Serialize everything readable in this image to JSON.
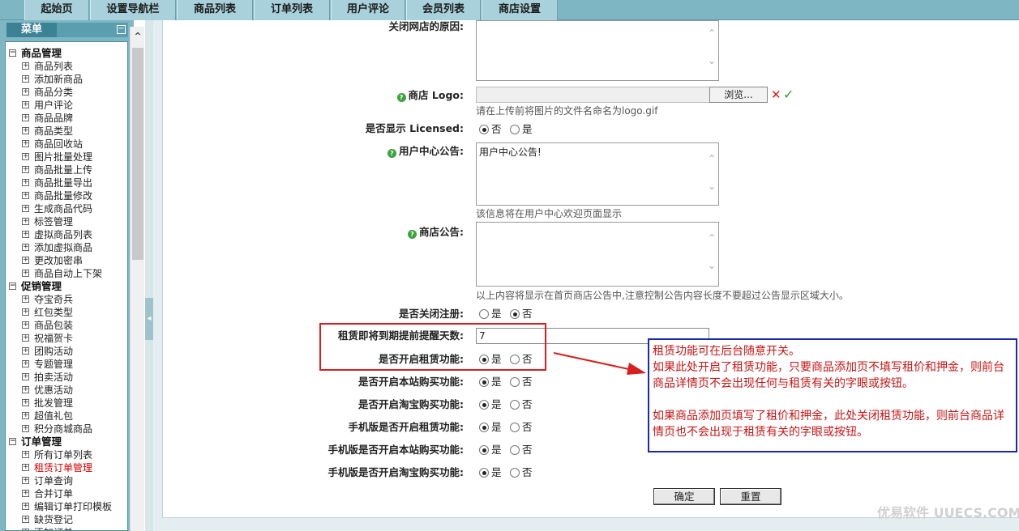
{
  "topnav": [
    "起始页",
    "设置导航栏",
    "商品列表",
    "订单列表",
    "用户评论",
    "会员列表",
    "商店设置"
  ],
  "menu": {
    "title": "菜单",
    "collapse": "−",
    "groups": [
      {
        "label": "商品管理",
        "items": [
          "商品列表",
          "添加新商品",
          "商品分类",
          "用户评论",
          "商品品牌",
          "商品类型",
          "商品回收站",
          "图片批量处理",
          "商品批量上传",
          "商品批量导出",
          "商品批量修改",
          "生成商品代码",
          "标签管理",
          "虚拟商品列表",
          "添加虚拟商品",
          "更改加密串",
          "商品自动上下架"
        ]
      },
      {
        "label": "促销管理",
        "items": [
          "夺宝奇兵",
          "红包类型",
          "商品包装",
          "祝福贺卡",
          "团购活动",
          "专题管理",
          "拍卖活动",
          "优惠活动",
          "批发管理",
          "超值礼包",
          "积分商城商品"
        ]
      },
      {
        "label": "订单管理",
        "items": [
          "所有订单列表",
          "租赁订单管理",
          "订单查询",
          "合并订单",
          "编辑订单打印模板",
          "缺货登记",
          "添加订单"
        ]
      }
    ],
    "active_item": "租赁订单管理"
  },
  "form": {
    "close_reason_label": "关闭网店的原因:",
    "close_reason_value": "",
    "logo_label": "商店  Logo:",
    "logo_browse": "浏览...",
    "logo_hint": "请在上传前将图片的文件名命名为logo.gif",
    "licensed_label": "是否显示  Licensed:",
    "licensed_opts": [
      "否",
      "是"
    ],
    "user_notice_label": "用户中心公告:",
    "user_notice_value": "用户中心公告!",
    "user_notice_hint": "该信息将在用户中心欢迎页面显示",
    "shop_notice_label": "商店公告:",
    "shop_notice_value": "",
    "shop_notice_hint": "以上内容将显示在首页商店公告中,注意控制公告内容长度不要超过公告显示区域大小。",
    "close_register_label": "是否关闭注册:",
    "close_register_opts": [
      "是",
      "否"
    ],
    "rent_days_label": "租赁即将到期提前提醒天数:",
    "rent_days_value": "7",
    "rent_enable_label": "是否开启租赁功能:",
    "site_buy_label": "是否开启本站购买功能:",
    "taobao_buy_label": "是否开启淘宝购买功能:",
    "mobile_rent_label": "手机版是否开启租赁功能:",
    "mobile_site_buy_label": "手机版是否开启本站购买功能:",
    "mobile_taobao_buy_label": "手机版是否开启淘宝购买功能:",
    "yes_no": [
      "是",
      "否"
    ],
    "submit": "确定",
    "reset": "重置"
  },
  "annotation": {
    "line1": "租赁功能可在后台随意开关。",
    "line2": "如果此处开启了租赁功能，只要商品添加页不填写租价和押金，则前台商品详情页不会出现任何与租赁有关的字眼或按钮。",
    "line3": "如果商品添加页填写了租价和押金，此处关闭租赁功能，则前台商品详情页也不会出现于租赁有关的字眼或按钮。"
  },
  "watermark": "优易软件 UUECS.COM",
  "colors": {
    "nav_bg": "#7fb6c4",
    "red_box": "#d81e1e",
    "note_border": "#1a2ab0",
    "note_text": "#c81414",
    "active_menu": "#d00000"
  }
}
